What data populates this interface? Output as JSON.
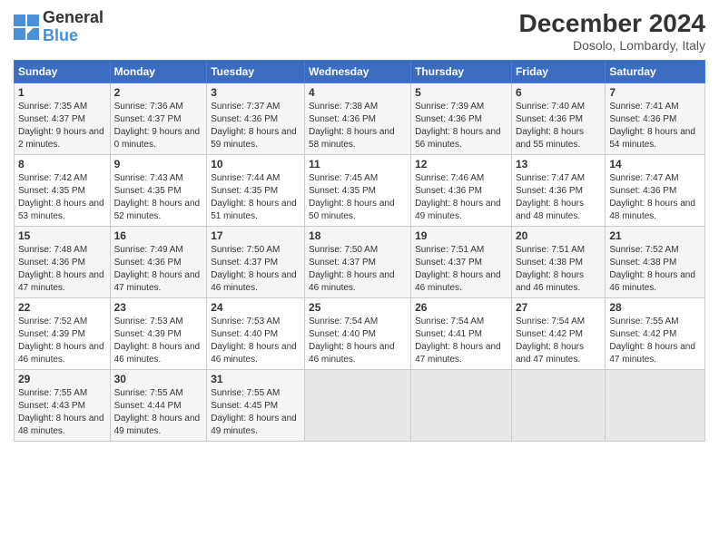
{
  "logo": {
    "text_general": "General",
    "text_blue": "Blue"
  },
  "title": "December 2024",
  "subtitle": "Dosolo, Lombardy, Italy",
  "columns": [
    "Sunday",
    "Monday",
    "Tuesday",
    "Wednesday",
    "Thursday",
    "Friday",
    "Saturday"
  ],
  "weeks": [
    [
      {
        "day": "1",
        "sunrise": "Sunrise: 7:35 AM",
        "sunset": "Sunset: 4:37 PM",
        "daylight": "Daylight: 9 hours and 2 minutes."
      },
      {
        "day": "2",
        "sunrise": "Sunrise: 7:36 AM",
        "sunset": "Sunset: 4:37 PM",
        "daylight": "Daylight: 9 hours and 0 minutes."
      },
      {
        "day": "3",
        "sunrise": "Sunrise: 7:37 AM",
        "sunset": "Sunset: 4:36 PM",
        "daylight": "Daylight: 8 hours and 59 minutes."
      },
      {
        "day": "4",
        "sunrise": "Sunrise: 7:38 AM",
        "sunset": "Sunset: 4:36 PM",
        "daylight": "Daylight: 8 hours and 58 minutes."
      },
      {
        "day": "5",
        "sunrise": "Sunrise: 7:39 AM",
        "sunset": "Sunset: 4:36 PM",
        "daylight": "Daylight: 8 hours and 56 minutes."
      },
      {
        "day": "6",
        "sunrise": "Sunrise: 7:40 AM",
        "sunset": "Sunset: 4:36 PM",
        "daylight": "Daylight: 8 hours and 55 minutes."
      },
      {
        "day": "7",
        "sunrise": "Sunrise: 7:41 AM",
        "sunset": "Sunset: 4:36 PM",
        "daylight": "Daylight: 8 hours and 54 minutes."
      }
    ],
    [
      {
        "day": "8",
        "sunrise": "Sunrise: 7:42 AM",
        "sunset": "Sunset: 4:35 PM",
        "daylight": "Daylight: 8 hours and 53 minutes."
      },
      {
        "day": "9",
        "sunrise": "Sunrise: 7:43 AM",
        "sunset": "Sunset: 4:35 PM",
        "daylight": "Daylight: 8 hours and 52 minutes."
      },
      {
        "day": "10",
        "sunrise": "Sunrise: 7:44 AM",
        "sunset": "Sunset: 4:35 PM",
        "daylight": "Daylight: 8 hours and 51 minutes."
      },
      {
        "day": "11",
        "sunrise": "Sunrise: 7:45 AM",
        "sunset": "Sunset: 4:35 PM",
        "daylight": "Daylight: 8 hours and 50 minutes."
      },
      {
        "day": "12",
        "sunrise": "Sunrise: 7:46 AM",
        "sunset": "Sunset: 4:36 PM",
        "daylight": "Daylight: 8 hours and 49 minutes."
      },
      {
        "day": "13",
        "sunrise": "Sunrise: 7:47 AM",
        "sunset": "Sunset: 4:36 PM",
        "daylight": "Daylight: 8 hours and 48 minutes."
      },
      {
        "day": "14",
        "sunrise": "Sunrise: 7:47 AM",
        "sunset": "Sunset: 4:36 PM",
        "daylight": "Daylight: 8 hours and 48 minutes."
      }
    ],
    [
      {
        "day": "15",
        "sunrise": "Sunrise: 7:48 AM",
        "sunset": "Sunset: 4:36 PM",
        "daylight": "Daylight: 8 hours and 47 minutes."
      },
      {
        "day": "16",
        "sunrise": "Sunrise: 7:49 AM",
        "sunset": "Sunset: 4:36 PM",
        "daylight": "Daylight: 8 hours and 47 minutes."
      },
      {
        "day": "17",
        "sunrise": "Sunrise: 7:50 AM",
        "sunset": "Sunset: 4:37 PM",
        "daylight": "Daylight: 8 hours and 46 minutes."
      },
      {
        "day": "18",
        "sunrise": "Sunrise: 7:50 AM",
        "sunset": "Sunset: 4:37 PM",
        "daylight": "Daylight: 8 hours and 46 minutes."
      },
      {
        "day": "19",
        "sunrise": "Sunrise: 7:51 AM",
        "sunset": "Sunset: 4:37 PM",
        "daylight": "Daylight: 8 hours and 46 minutes."
      },
      {
        "day": "20",
        "sunrise": "Sunrise: 7:51 AM",
        "sunset": "Sunset: 4:38 PM",
        "daylight": "Daylight: 8 hours and 46 minutes."
      },
      {
        "day": "21",
        "sunrise": "Sunrise: 7:52 AM",
        "sunset": "Sunset: 4:38 PM",
        "daylight": "Daylight: 8 hours and 46 minutes."
      }
    ],
    [
      {
        "day": "22",
        "sunrise": "Sunrise: 7:52 AM",
        "sunset": "Sunset: 4:39 PM",
        "daylight": "Daylight: 8 hours and 46 minutes."
      },
      {
        "day": "23",
        "sunrise": "Sunrise: 7:53 AM",
        "sunset": "Sunset: 4:39 PM",
        "daylight": "Daylight: 8 hours and 46 minutes."
      },
      {
        "day": "24",
        "sunrise": "Sunrise: 7:53 AM",
        "sunset": "Sunset: 4:40 PM",
        "daylight": "Daylight: 8 hours and 46 minutes."
      },
      {
        "day": "25",
        "sunrise": "Sunrise: 7:54 AM",
        "sunset": "Sunset: 4:40 PM",
        "daylight": "Daylight: 8 hours and 46 minutes."
      },
      {
        "day": "26",
        "sunrise": "Sunrise: 7:54 AM",
        "sunset": "Sunset: 4:41 PM",
        "daylight": "Daylight: 8 hours and 47 minutes."
      },
      {
        "day": "27",
        "sunrise": "Sunrise: 7:54 AM",
        "sunset": "Sunset: 4:42 PM",
        "daylight": "Daylight: 8 hours and 47 minutes."
      },
      {
        "day": "28",
        "sunrise": "Sunrise: 7:55 AM",
        "sunset": "Sunset: 4:42 PM",
        "daylight": "Daylight: 8 hours and 47 minutes."
      }
    ],
    [
      {
        "day": "29",
        "sunrise": "Sunrise: 7:55 AM",
        "sunset": "Sunset: 4:43 PM",
        "daylight": "Daylight: 8 hours and 48 minutes."
      },
      {
        "day": "30",
        "sunrise": "Sunrise: 7:55 AM",
        "sunset": "Sunset: 4:44 PM",
        "daylight": "Daylight: 8 hours and 49 minutes."
      },
      {
        "day": "31",
        "sunrise": "Sunrise: 7:55 AM",
        "sunset": "Sunset: 4:45 PM",
        "daylight": "Daylight: 8 hours and 49 minutes."
      },
      null,
      null,
      null,
      null
    ]
  ]
}
